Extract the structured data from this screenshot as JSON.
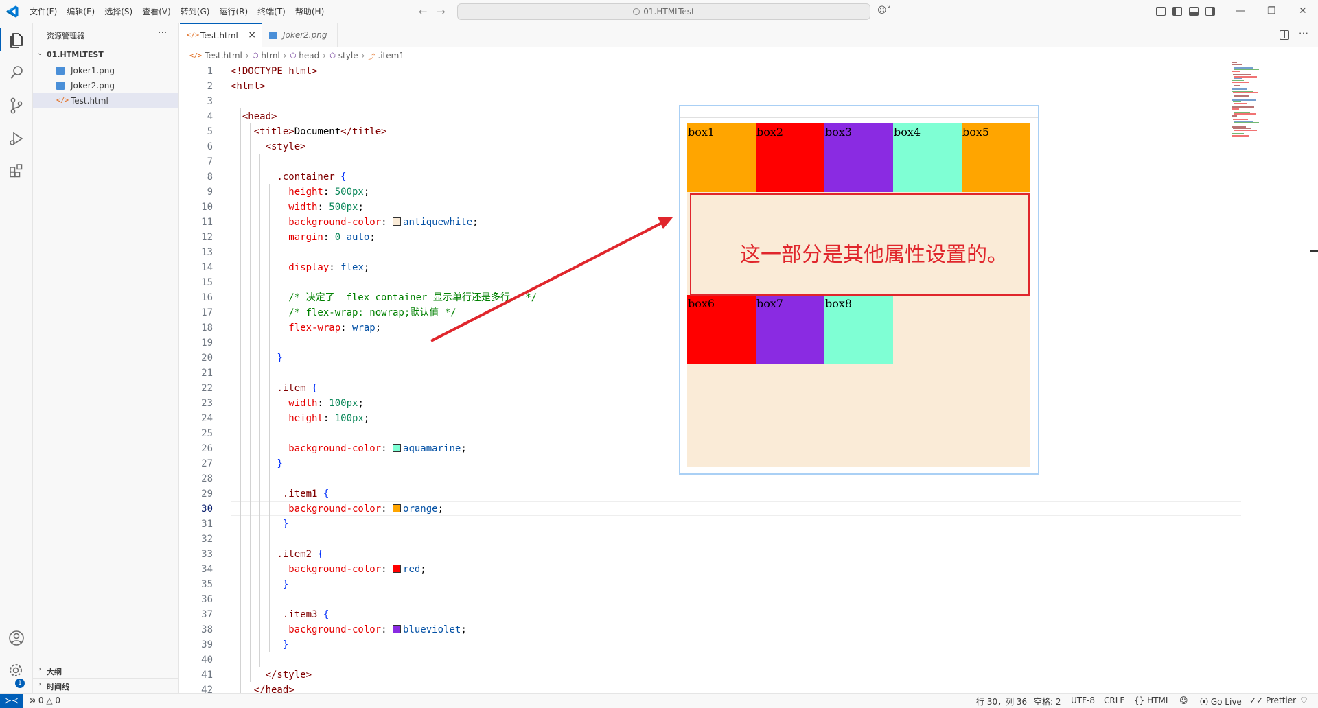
{
  "menu": [
    "文件(F)",
    "编辑(E)",
    "选择(S)",
    "查看(V)",
    "转到(G)",
    "运行(R)",
    "终端(T)",
    "帮助(H)"
  ],
  "search": {
    "text": "01.HTMLTest"
  },
  "sidebar": {
    "title": "资源管理器",
    "more": "···",
    "folder": "01.HTMLTEST",
    "files": [
      {
        "name": "Joker1.png",
        "type": "image"
      },
      {
        "name": "Joker2.png",
        "type": "image"
      },
      {
        "name": "Test.html",
        "type": "html",
        "active": true
      }
    ],
    "outline_label": "大纲",
    "timeline_label": "时间线"
  },
  "activity": {
    "settings_badge": "1"
  },
  "tabs": [
    {
      "label": "Test.html",
      "active": true,
      "close": "×"
    },
    {
      "label": "Joker2.png",
      "active": false,
      "italic": true
    }
  ],
  "breadcrumb": [
    "Test.html",
    "html",
    "head",
    "style",
    ".item1"
  ],
  "editor": {
    "current_line": 30,
    "lines": [
      [
        [
          "tag",
          "<!DOCTYPE html>"
        ]
      ],
      [
        [
          "tag",
          "<html>"
        ]
      ],
      [],
      [
        [
          "tag",
          "  <head>"
        ]
      ],
      [
        [
          "tag",
          "    <title>"
        ],
        [
          "txt",
          "Document"
        ],
        [
          "tag",
          "</title>"
        ]
      ],
      [
        [
          "tag",
          "      <style>"
        ]
      ],
      [],
      [
        [
          "sel",
          "        .container "
        ],
        [
          "br",
          "{"
        ]
      ],
      [
        [
          "prop",
          "          height"
        ],
        [
          "txt",
          ": "
        ],
        [
          "num",
          "500px"
        ],
        [
          "txt",
          ";"
        ]
      ],
      [
        [
          "prop",
          "          width"
        ],
        [
          "txt",
          ": "
        ],
        [
          "num",
          "500px"
        ],
        [
          "txt",
          ";"
        ]
      ],
      [
        [
          "prop",
          "          background-color"
        ],
        [
          "txt",
          ": "
        ],
        [
          "swatch",
          "#faebd7"
        ],
        [
          "val",
          "antiquewhite"
        ],
        [
          "txt",
          ";"
        ]
      ],
      [
        [
          "prop",
          "          margin"
        ],
        [
          "txt",
          ": "
        ],
        [
          "num",
          "0"
        ],
        [
          "txt",
          " "
        ],
        [
          "val",
          "auto"
        ],
        [
          "txt",
          ";"
        ]
      ],
      [],
      [
        [
          "prop",
          "          display"
        ],
        [
          "txt",
          ": "
        ],
        [
          "val",
          "flex"
        ],
        [
          "txt",
          ";"
        ]
      ],
      [],
      [
        [
          "com",
          "          /* 决定了  flex container 显示单行还是多行。 */"
        ]
      ],
      [
        [
          "com",
          "          /* flex-wrap: nowrap;默认值 */"
        ]
      ],
      [
        [
          "prop",
          "          flex-wrap"
        ],
        [
          "txt",
          ": "
        ],
        [
          "val",
          "wrap"
        ],
        [
          "txt",
          ";"
        ]
      ],
      [],
      [
        [
          "br",
          "        }"
        ]
      ],
      [],
      [
        [
          "sel",
          "        .item "
        ],
        [
          "br",
          "{"
        ]
      ],
      [
        [
          "prop",
          "          width"
        ],
        [
          "txt",
          ": "
        ],
        [
          "num",
          "100px"
        ],
        [
          "txt",
          ";"
        ]
      ],
      [
        [
          "prop",
          "          height"
        ],
        [
          "txt",
          ": "
        ],
        [
          "num",
          "100px"
        ],
        [
          "txt",
          ";"
        ]
      ],
      [],
      [
        [
          "prop",
          "          background-color"
        ],
        [
          "txt",
          ": "
        ],
        [
          "swatch",
          "#7fffd4"
        ],
        [
          "val",
          "aquamarine"
        ],
        [
          "txt",
          ";"
        ]
      ],
      [
        [
          "br",
          "        }"
        ]
      ],
      [],
      [
        [
          "sel",
          "         .item1 "
        ],
        [
          "br",
          "{"
        ]
      ],
      [
        [
          "prop",
          "          background-color"
        ],
        [
          "txt",
          ": "
        ],
        [
          "swatch",
          "#ffa500"
        ],
        [
          "val",
          "orange"
        ],
        [
          "txt",
          ";"
        ]
      ],
      [
        [
          "br",
          "         }"
        ]
      ],
      [],
      [
        [
          "sel",
          "        .item2 "
        ],
        [
          "br",
          "{"
        ]
      ],
      [
        [
          "prop",
          "          background-color"
        ],
        [
          "txt",
          ": "
        ],
        [
          "swatch",
          "#ff0000"
        ],
        [
          "val",
          "red"
        ],
        [
          "txt",
          ";"
        ]
      ],
      [
        [
          "br",
          "         }"
        ]
      ],
      [],
      [
        [
          "sel",
          "         .item3 "
        ],
        [
          "br",
          "{"
        ]
      ],
      [
        [
          "prop",
          "          background-color"
        ],
        [
          "txt",
          ": "
        ],
        [
          "swatch",
          "#8a2be2"
        ],
        [
          "val",
          "blueviolet"
        ],
        [
          "txt",
          ";"
        ]
      ],
      [
        [
          "br",
          "         }"
        ]
      ],
      [],
      [
        [
          "tag",
          "      </style>"
        ]
      ],
      [
        [
          "tag",
          "    </head>"
        ]
      ]
    ]
  },
  "preview": {
    "container_bg": "antiquewhite",
    "boxes": [
      {
        "label": "box1",
        "color": "#ffa500"
      },
      {
        "label": "box2",
        "color": "#ff0000"
      },
      {
        "label": "box3",
        "color": "#8a2be2"
      },
      {
        "label": "box4",
        "color": "#7fffd4"
      },
      {
        "label": "box5",
        "color": "#ffa500"
      },
      {
        "label": "box6",
        "color": "#ff0000"
      },
      {
        "label": "box7",
        "color": "#8a2be2"
      },
      {
        "label": "box8",
        "color": "#7fffd4"
      }
    ],
    "annotation": "这一部分是其他属性设置的。",
    "annotation_color": "#e0262c"
  },
  "status": {
    "problems_errors": "0",
    "problems_warnings": "0",
    "position": "行 30，列 36",
    "spaces": "空格: 2",
    "encoding": "UTF-8",
    "eol": "CRLF",
    "language": "HTML",
    "golive": "Go Live",
    "prettier": "Prettier"
  },
  "colors": {
    "accent": "#005fb8",
    "vscode_blue": "#0078d4"
  }
}
